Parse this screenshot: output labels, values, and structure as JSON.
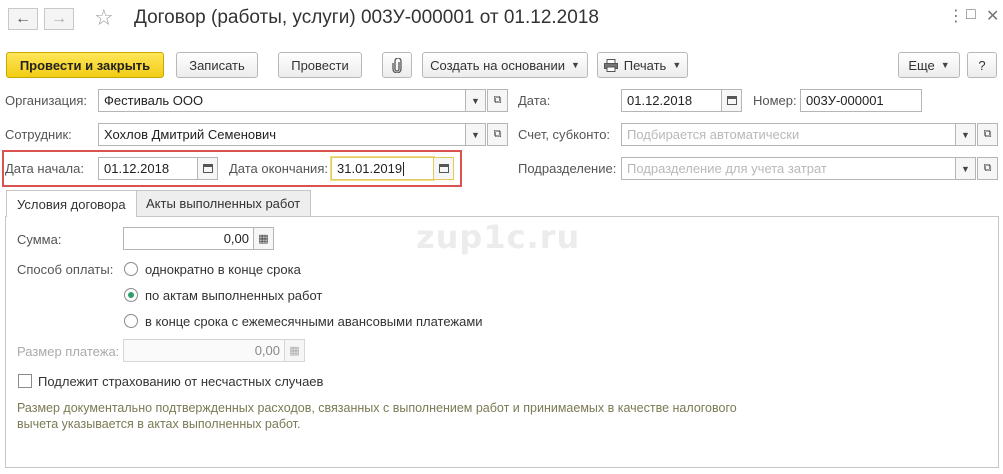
{
  "window": {
    "title": "Договор (работы, услуги) 003У-000001 от 01.12.2018",
    "back_icon": "arrow-left-icon",
    "forward_icon": "arrow-right-icon",
    "favorite_icon": "star-icon",
    "menu_glyph": "⋮",
    "restore_glyph": "□",
    "close_glyph": "✕"
  },
  "toolbar": {
    "post_and_close": "Провести и закрыть",
    "save": "Записать",
    "post": "Провести",
    "attach_icon": "paperclip-icon",
    "create_based_on": "Создать на основании",
    "print": "Печать",
    "more": "Еще",
    "help": "?"
  },
  "form": {
    "organization": {
      "label": "Организация:",
      "value": "Фестиваль ООО"
    },
    "employee": {
      "label": "Сотрудник:",
      "value": "Хохлов Дмитрий Семенович"
    },
    "start_date": {
      "label": "Дата начала:",
      "value": "01.12.2018"
    },
    "end_date": {
      "label": "Дата окончания:",
      "value": "31.01.2019"
    },
    "date": {
      "label": "Дата:",
      "value": "01.12.2018"
    },
    "number": {
      "label": "Номер:",
      "value": "003У-000001"
    },
    "account": {
      "label": "Счет, субконто:",
      "placeholder": "Подбирается автоматически"
    },
    "department": {
      "label": "Подразделение:",
      "placeholder": "Подразделение для учета затрат"
    }
  },
  "tabs": [
    {
      "label": "Условия договора",
      "active": true
    },
    {
      "label": "Акты выполненных работ",
      "active": false
    }
  ],
  "terms": {
    "amount": {
      "label": "Сумма:",
      "value": "0,00"
    },
    "payment_method": {
      "label": "Способ оплаты:",
      "options": [
        {
          "label": "однократно в конце срока",
          "selected": false
        },
        {
          "label": "по актам выполненных работ",
          "selected": true
        },
        {
          "label": "в конце срока с ежемесячными авансовыми платежами",
          "selected": false
        }
      ]
    },
    "payment_size": {
      "label": "Размер платежа:",
      "value": "0,00"
    },
    "insurance": {
      "label": "Подлежит страхованию от несчастных случаев",
      "checked": false
    },
    "note": "Размер документально подтвержденных расходов, связанных с выполнением работ и принимаемых в качестве налогового вычета указывается в актах выполненных работ."
  },
  "watermark": "zup1c.ru",
  "colors": {
    "primary_button": "#f2cc14",
    "highlight_border": "#d9534f",
    "radio_selected": "#2f9e6a"
  }
}
